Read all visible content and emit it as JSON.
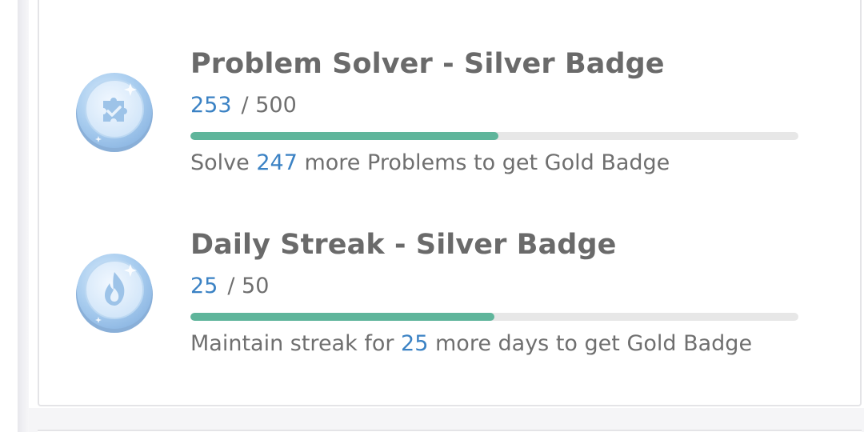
{
  "badges": [
    {
      "title": "Problem Solver - Silver Badge",
      "current": "253",
      "total": "/ 500",
      "progress_fraction": 0.506,
      "hint_prefix": "Solve",
      "hint_number": "247",
      "hint_suffix": "more Problems to get Gold Badge",
      "icon": "puzzle-check-icon"
    },
    {
      "title": "Daily Streak - Silver Badge",
      "current": "25",
      "total": "/ 50",
      "progress_fraction": 0.5,
      "hint_prefix": "Maintain streak for",
      "hint_number": "25",
      "hint_suffix": "more days to get Gold Badge",
      "icon": "flame-icon"
    }
  ],
  "colors": {
    "accent_blue": "#3b82c4",
    "progress_green": "#5fb59b",
    "track_gray": "#e7e7e7",
    "text_gray": "#6f6f6f"
  }
}
